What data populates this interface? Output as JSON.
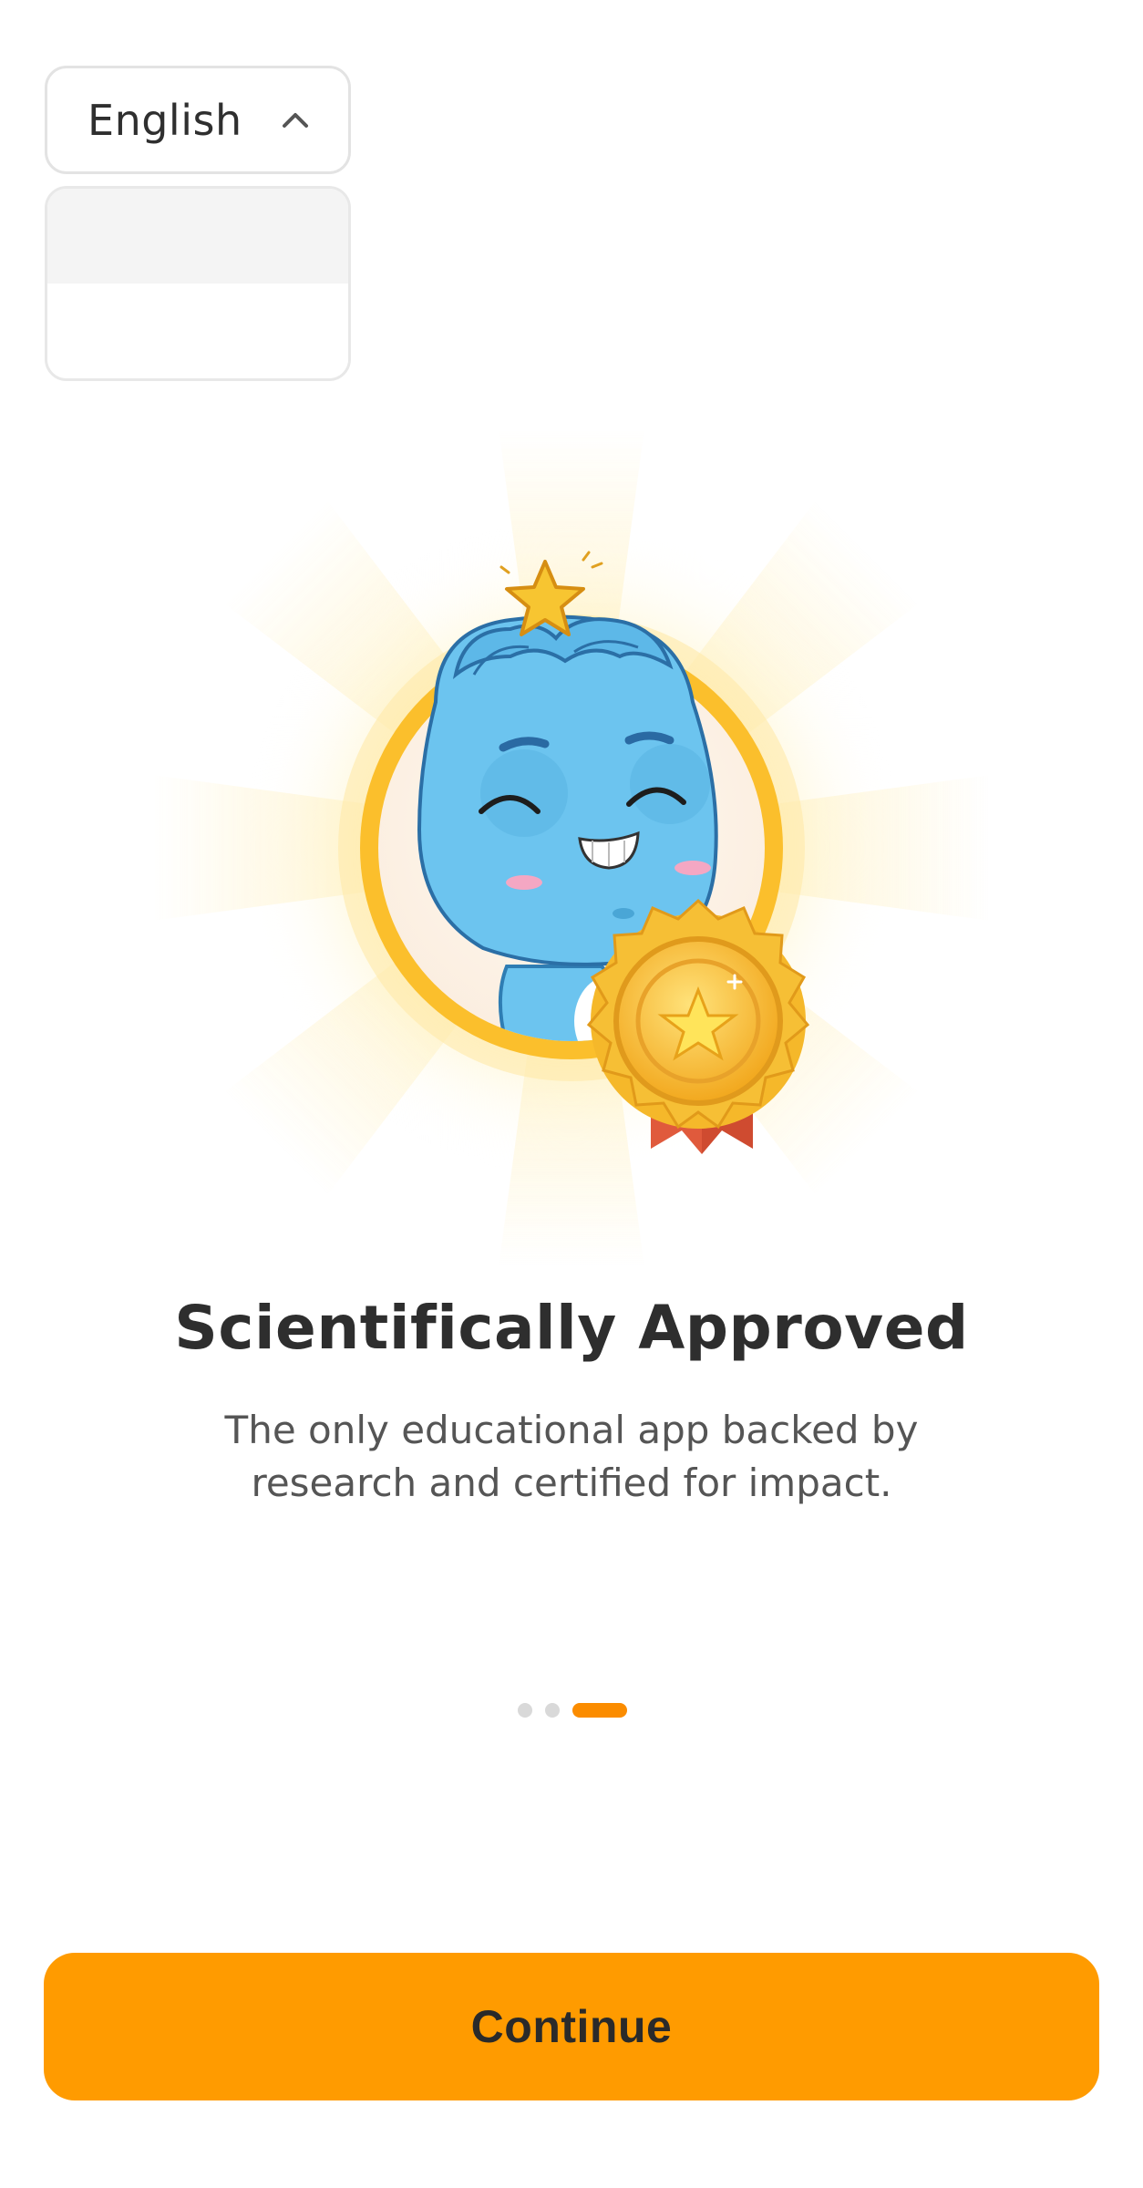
{
  "language_selector": {
    "selected": "English",
    "icon": "chevron-up-icon",
    "expanded": true
  },
  "hero": {
    "illustration": "blue-mascot-with-gold-medal",
    "colors": {
      "glow": "#ffd45a",
      "ring": "#fbbf2c",
      "mascot": "#6cc4ef",
      "medal": "#f5b82a",
      "ribbon": "#e05a3c"
    }
  },
  "content": {
    "title": "Scientifically Approved",
    "subtitle": "The only educational app backed by research and certified for impact."
  },
  "pager": {
    "total": 3,
    "active_index": 2
  },
  "footer": {
    "continue_label": "Continue",
    "accent": "#ff9b00"
  }
}
